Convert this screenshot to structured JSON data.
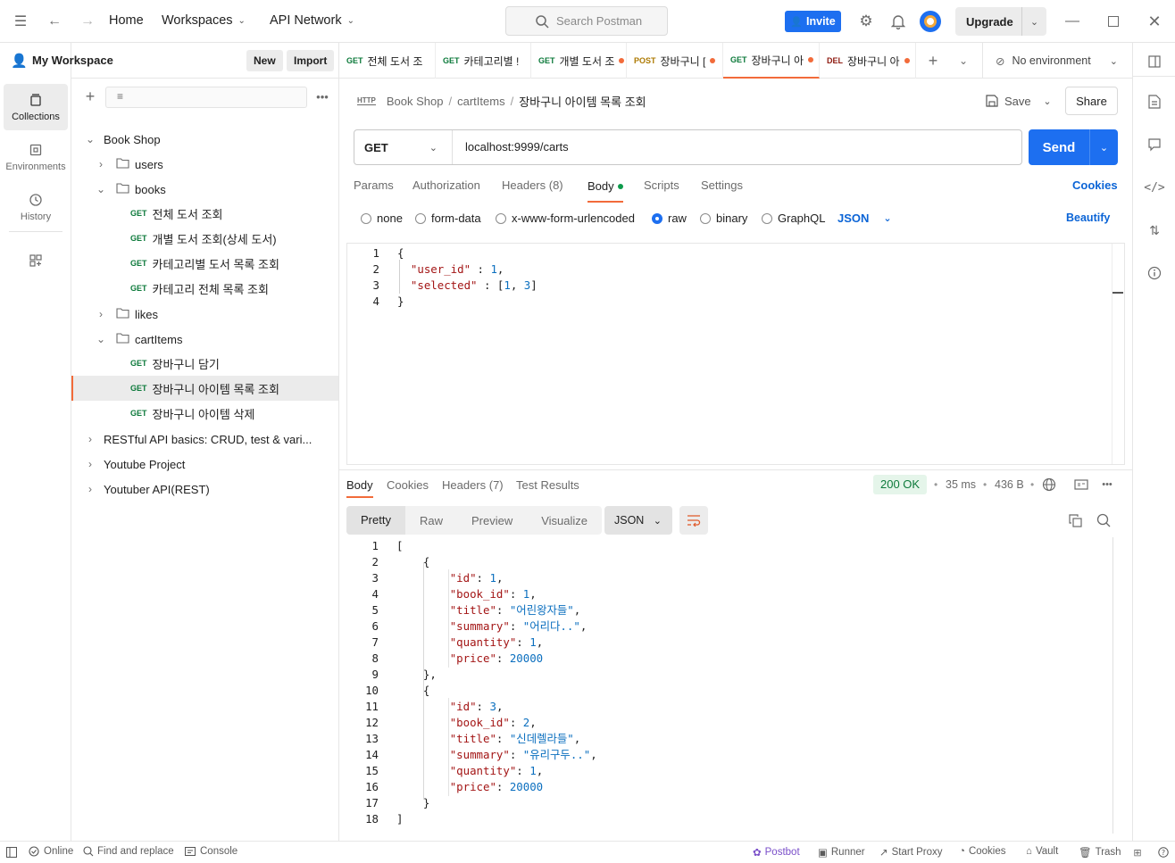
{
  "topbar": {
    "home": "Home",
    "workspaces": "Workspaces",
    "api_network": "API Network",
    "search_placeholder": "Search Postman",
    "invite": "Invite",
    "upgrade": "Upgrade"
  },
  "leftnav": [
    {
      "label": "Collections",
      "icon": "collections-icon"
    },
    {
      "label": "Environments",
      "icon": "environments-icon"
    },
    {
      "label": "History",
      "icon": "history-icon"
    }
  ],
  "sidebar": {
    "workspace": "My Workspace",
    "new_btn": "New",
    "import_btn": "Import",
    "tree": [
      {
        "label": "Book Shop",
        "level": 0,
        "kind": "collection",
        "open": true
      },
      {
        "label": "users",
        "level": 1,
        "kind": "folder",
        "open": false
      },
      {
        "label": "books",
        "level": 1,
        "kind": "folder",
        "open": true
      },
      {
        "label": "전체 도서 조회",
        "level": 2,
        "kind": "request",
        "method": "GET"
      },
      {
        "label": "개별 도서 조회(상세 도서)",
        "level": 2,
        "kind": "request",
        "method": "GET"
      },
      {
        "label": "카테고리별 도서 목록 조회",
        "level": 2,
        "kind": "request",
        "method": "GET"
      },
      {
        "label": "카테고리 전체 목록 조회",
        "level": 2,
        "kind": "request",
        "method": "GET"
      },
      {
        "label": "likes",
        "level": 1,
        "kind": "folder",
        "open": false
      },
      {
        "label": "cartItems",
        "level": 1,
        "kind": "folder",
        "open": true
      },
      {
        "label": "장바구니 담기",
        "level": 2,
        "kind": "request",
        "method": "GET"
      },
      {
        "label": "장바구니 아이템 목록 조회",
        "level": 2,
        "kind": "request",
        "method": "GET",
        "selected": true
      },
      {
        "label": "장바구니 아이템 삭제",
        "level": 2,
        "kind": "request",
        "method": "GET"
      },
      {
        "label": "RESTful API basics: CRUD, test & vari...",
        "level": 0,
        "kind": "collection",
        "open": false
      },
      {
        "label": "Youtube Project",
        "level": 0,
        "kind": "collection",
        "open": false
      },
      {
        "label": "Youtuber API(REST)",
        "level": 0,
        "kind": "collection",
        "open": false
      }
    ]
  },
  "tabs": [
    {
      "method": "GET",
      "label": "전체 도서 조",
      "dirty": false
    },
    {
      "method": "GET",
      "label": "카테고리별 !",
      "dirty": false
    },
    {
      "method": "GET",
      "label": "개별 도서 조",
      "dirty": true
    },
    {
      "method": "POST",
      "label": "장바구니 [",
      "dirty": true
    },
    {
      "method": "GET",
      "label": "장바구니 아",
      "dirty": true,
      "active": true
    },
    {
      "method": "DEL",
      "label": "장바구니 아",
      "dirty": true
    }
  ],
  "environment": "No environment",
  "breadcrumb": {
    "collection": "Book Shop",
    "folder": "cartItems",
    "request": "장바구니 아이템 목록 조회",
    "save": "Save",
    "share": "Share"
  },
  "request": {
    "method": "GET",
    "url": "localhost:9999/carts",
    "send": "Send",
    "tabs": [
      "Params",
      "Authorization",
      "Headers (8)",
      "Body",
      "Scripts",
      "Settings"
    ],
    "cookies": "Cookies",
    "body_types": [
      "none",
      "form-data",
      "x-www-form-urlencoded",
      "raw",
      "binary",
      "GraphQL"
    ],
    "body_format": "JSON",
    "beautify": "Beautify",
    "body_lines": [
      "{",
      "  \"user_id\" : 1,",
      "  \"selected\" : [1, 3]",
      "}"
    ]
  },
  "response": {
    "tabs": [
      "Body",
      "Cookies",
      "Headers (7)",
      "Test Results"
    ],
    "status": "200 OK",
    "time": "35 ms",
    "size": "436 B",
    "view_tabs": [
      "Pretty",
      "Raw",
      "Preview",
      "Visualize"
    ],
    "format": "JSON",
    "lines": [
      "[",
      "    {",
      "        \"id\": 1,",
      "        \"book_id\": 1,",
      "        \"title\": \"어린왕자들\",",
      "        \"summary\": \"어리다..\",",
      "        \"quantity\": 1,",
      "        \"price\": 20000",
      "    },",
      "    {",
      "        \"id\": 3,",
      "        \"book_id\": 2,",
      "        \"title\": \"신데렐라들\",",
      "        \"summary\": \"유리구두..\",",
      "        \"quantity\": 1,",
      "        \"price\": 20000",
      "    }",
      "]"
    ]
  },
  "statusbar": {
    "online": "Online",
    "find_replace": "Find and replace",
    "console": "Console",
    "postbot": "Postbot",
    "runner": "Runner",
    "start_proxy": "Start Proxy",
    "cookies": "Cookies",
    "vault": "Vault",
    "trash": "Trash"
  }
}
